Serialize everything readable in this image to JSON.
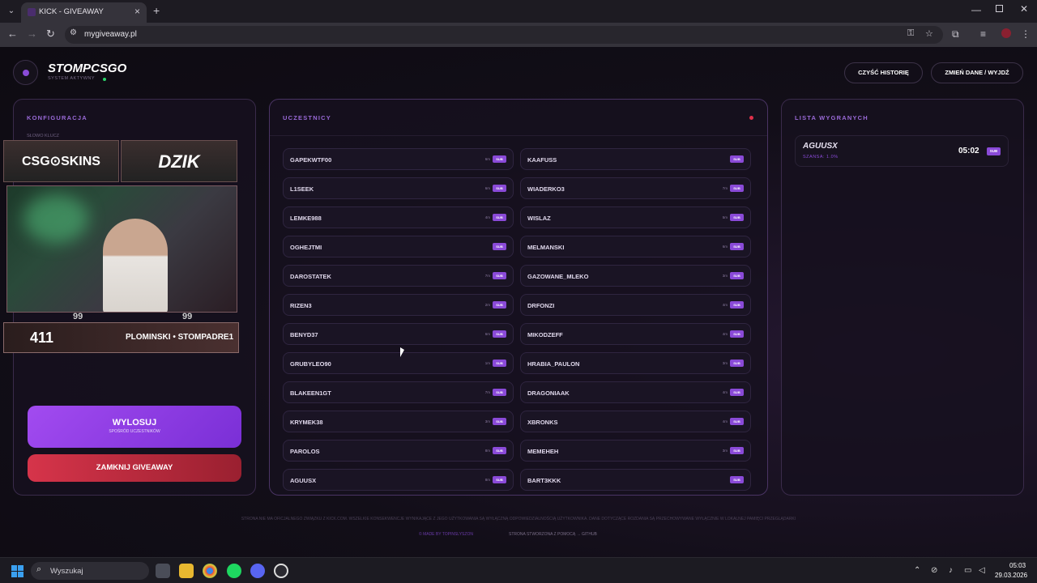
{
  "browser": {
    "tab_title": "KICK - GIVEAWAY",
    "url": "mygiveaway.pl"
  },
  "header": {
    "brand": "STOMPCSGO",
    "status": "SYSTEM AKTYWNY",
    "clear_history": "CZYŚĆ HISTORIĘ",
    "change_exit": "ZMIEŃ DANE / WYJDŹ"
  },
  "config": {
    "title": "KONFIGURACJA",
    "keyword_label": "SŁOWO KLUCZ",
    "overlay": {
      "logo_left": "CSG⊙SKINS",
      "logo_right": "DZIK",
      "num_left": "99",
      "num_right": "99",
      "count": "411",
      "social": "PLOMINSKI • STOMPADRE1"
    },
    "draw_label": "WYLOSUJ",
    "draw_sub": "SPOŚRÓD UCZESTNIKÓW",
    "close_label": "ZAMKNIJ GIVEAWAY"
  },
  "participants": {
    "title": "UCZESTNICY",
    "badge": "SUB",
    "items": [
      {
        "name": "GAPEKWTF00",
        "time": "6m"
      },
      {
        "name": "KAAFUSS",
        "time": ""
      },
      {
        "name": "L1SEEK",
        "time": "6m"
      },
      {
        "name": "WIADERKO3",
        "time": "7m"
      },
      {
        "name": "LEMKE988",
        "time": "4m"
      },
      {
        "name": "WISLAZ",
        "time": "5m"
      },
      {
        "name": "OGHEJTMI",
        "time": ""
      },
      {
        "name": "MELMANSKI",
        "time": "6m"
      },
      {
        "name": "DAROSTATEK",
        "time": "7m"
      },
      {
        "name": "GAZOWANE_MLEKO",
        "time": "3m"
      },
      {
        "name": "RIZEN3",
        "time": "2m"
      },
      {
        "name": "DRFONZI",
        "time": "4m"
      },
      {
        "name": "BENYD37",
        "time": "6m"
      },
      {
        "name": "MIKODZEFF",
        "time": "4m"
      },
      {
        "name": "GRUBYLEO90",
        "time": "1m"
      },
      {
        "name": "HRABIA_PAULON",
        "time": "3m"
      },
      {
        "name": "BLAKEEN1GT",
        "time": "7m"
      },
      {
        "name": "DRAGONIAAK",
        "time": "4m"
      },
      {
        "name": "KRYMEK38",
        "time": "3m"
      },
      {
        "name": "XBRONKS",
        "time": "4m"
      },
      {
        "name": "PAROLOS",
        "time": "8m"
      },
      {
        "name": "MEMEHEH",
        "time": "3m"
      },
      {
        "name": "AGUUSX",
        "time": "8m"
      },
      {
        "name": "BART3KKK",
        "time": ""
      }
    ]
  },
  "winners": {
    "title": "LISTA WYGRANYCH",
    "items": [
      {
        "name": "AGUUSX",
        "chance": "SZANSA: 1.0%",
        "time": "05:02",
        "badge": "SUB"
      }
    ]
  },
  "footer": {
    "disclaimer": "STRONA NIE MA OFICJALNEGO ZWIĄZKU Z KICK.COM. WSZELKIE KONSEKWENCJE WYNIKAJĄCE Z JEGO UŻYTKOWANIA SĄ WYŁĄCZNĄ ODPOWIEDZIALNOŚCIĄ UŻYTKOWNIKA. DANE DOTYCZĄCE ROZDANIA SĄ PRZECHOWYWANE WYŁĄCZNIE W LOKALNEJ PAMIĘCI PRZEGLĄDARKI",
    "made_by": "© MADE BY TOPINSLYSZON",
    "credit": "STRONA STWORZONA Z POMOCĄ → GITHUB"
  },
  "taskbar": {
    "search": "Wyszukaj",
    "time": "05:03",
    "date": "29.03.2026"
  },
  "colors": {
    "accent": "#8a4ad8",
    "danger": "#d6344a",
    "online": "#2bd46b"
  }
}
